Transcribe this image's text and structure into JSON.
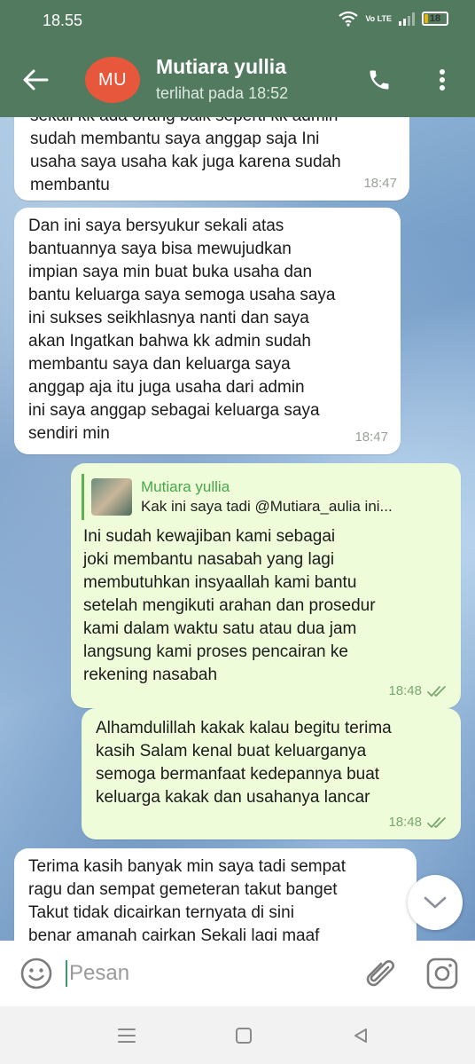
{
  "status_bar": {
    "time": "18.55",
    "network_label": "Vo LTE",
    "battery_level": "18"
  },
  "header": {
    "avatar_initials": "MU",
    "contact_name": "Mutiara yullia",
    "last_seen": "terlihat pada  18:52",
    "icons": [
      "back-arrow-icon",
      "phone-icon",
      "more-vert-icon"
    ]
  },
  "messages": [
    {
      "direction": "incoming",
      "text": "sekali kk ada orang baik seperti kk admin\nsudah membantu saya anggap saja Ini\nusaha saya usaha kak juga karena sudah\nmembantu",
      "time": "18:47"
    },
    {
      "direction": "incoming",
      "text": "Dan ini saya bersyukur sekali atas\nbantuannya saya bisa mewujudkan\nimpian saya min buat buka usaha dan\nbantu keluarga saya semoga usaha saya\nini sukses seikhlasnya nanti dan saya\nakan Ingatkan bahwa kk admin sudah\nmembantu saya dan keluarga saya\nanggap aja itu juga usaha dari admin\nini saya anggap sebagai keluarga saya\nsendiri min",
      "time": "18:47"
    },
    {
      "direction": "outgoing",
      "reply_to": {
        "name": "Mutiara yullia",
        "text": "Kak ini saya tadi @Mutiara_aulia ini..."
      },
      "text": "Ini sudah kewajiban kami sebagai\njoki membantu nasabah yang lagi\nmembutuhkan insyaallah kami bantu\nsetelah mengikuti arahan dan prosedur\nkami dalam waktu satu atau dua jam\nlangsung kami proses pencairan ke\nrekening nasabah",
      "time": "18:48",
      "status": "read"
    },
    {
      "direction": "outgoing",
      "text": "Alhamdulillah kakak kalau begitu terima\nkasih Salam kenal buat keluarganya\nsemoga bermanfaat kedepannya buat\nkeluarga kakak dan usahanya lancar",
      "time": "18:48",
      "status": "read"
    },
    {
      "direction": "incoming",
      "text": "Terima kasih banyak min saya tadi sempat\nragu dan sempat gemeteran takut banget\nTakut tidak dicairkan ternyata di sini\nbenar amanah cairkan Sekali lagi maaf",
      "time": ""
    }
  ],
  "composer": {
    "placeholder": "Pesan",
    "value": "",
    "icons": [
      "emoji-icon",
      "attach-icon",
      "camera-icon"
    ]
  },
  "nav": {
    "icons": [
      "recent-apps-icon",
      "home-icon",
      "back-icon"
    ]
  },
  "colors": {
    "header": "#517a5f",
    "incoming_bubble": "#ffffff",
    "outgoing_bubble": "#eefcd9",
    "avatar": "#e6573b",
    "accent_green": "#4aa64a",
    "read_check": "#79a870"
  }
}
